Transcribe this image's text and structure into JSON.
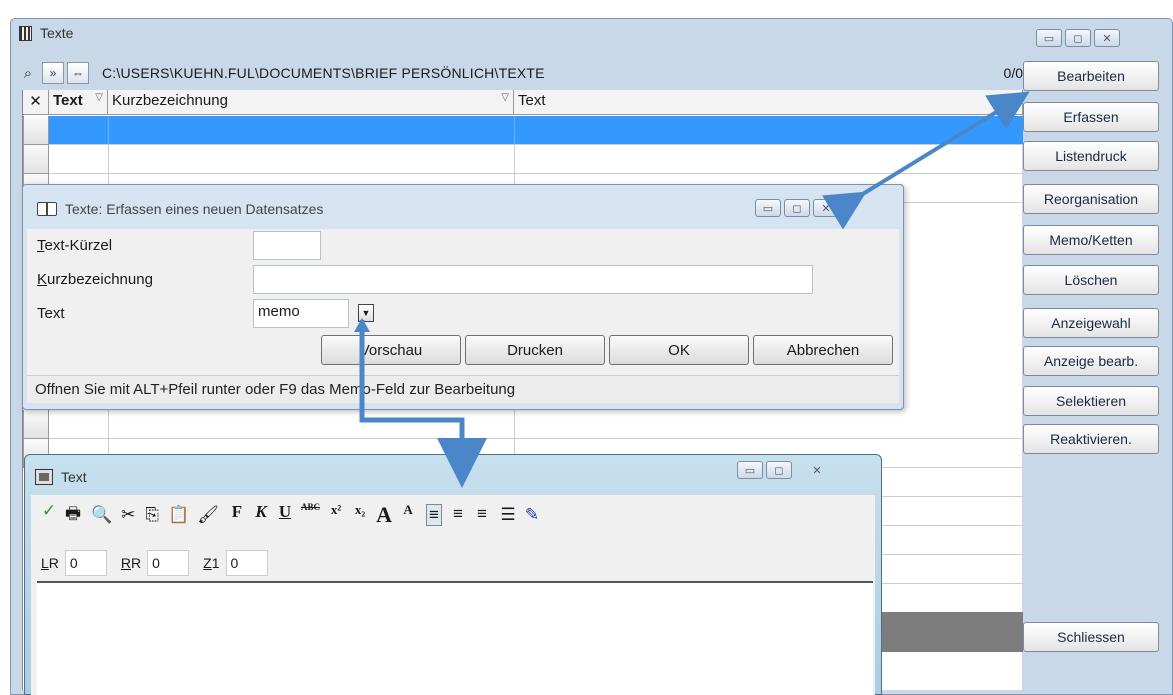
{
  "main": {
    "title": "Texte",
    "path": "C:\\USERS\\KUEHN.FUL\\DOCUMENTS\\BRIEF PERSÖNLICH\\TEXTE",
    "record_counter": "0/0",
    "nav_next": "»",
    "nav_link": "⇔",
    "grid": {
      "columns": [
        "Text",
        "Kurzbezeichnung",
        "Text"
      ],
      "delete_header": "✕"
    },
    "side_buttons": [
      "Bearbeiten",
      "Erfassen",
      "Listendruck",
      "Reorganisation",
      "Memo/Ketten",
      "Löschen",
      "Anzeigewahl",
      "Anzeige bearb.",
      "Selektieren",
      "Reaktivieren."
    ],
    "close_button": "Schliessen"
  },
  "dialog": {
    "title": "Texte: Erfassen eines neuen Datensatzes",
    "label_text_kuerzel_first": "T",
    "label_text_kuerzel_rest": "ext-Kürzel",
    "label_kurzbez_first": "K",
    "label_kurzbez_rest": "urzbezeichnung",
    "label_text": "Text",
    "text_value": "memo",
    "dropdown_glyph": "▼",
    "buttons": [
      "Vorschau",
      "Drucken",
      "OK",
      "Abbrechen"
    ],
    "status": "Offnen Sie mit ALT+Pfeil runter oder F9 das Memo-Feld zur Bearbeitung"
  },
  "editor": {
    "title": "Text",
    "toolbar": {
      "check": "✓",
      "print": "🖶",
      "find": "🔍",
      "cut": "✂",
      "copy": "⎘",
      "paste": "📋",
      "brush": "🖌",
      "bold": "F",
      "italic": "K",
      "underline": "U",
      "strike": "ABC",
      "sup": "x²",
      "sub": "x₂",
      "grow": "A",
      "shrink": "A",
      "align_left": "≡",
      "align_center": "≡",
      "align_right": "≡",
      "list": "☰",
      "pen": "✎"
    },
    "lr_label_first": "L",
    "lr_label_rest": "R",
    "lr_value": "0",
    "rr_label_first": "R",
    "rr_label_rest": "R",
    "rr_value": "0",
    "z1_label_first": "Z",
    "z1_label_rest": "1",
    "z1_value": "0"
  },
  "colors": {
    "selection": "#3399ff",
    "arrow": "#4a86c8",
    "window_frame": "#c9d8e8"
  }
}
